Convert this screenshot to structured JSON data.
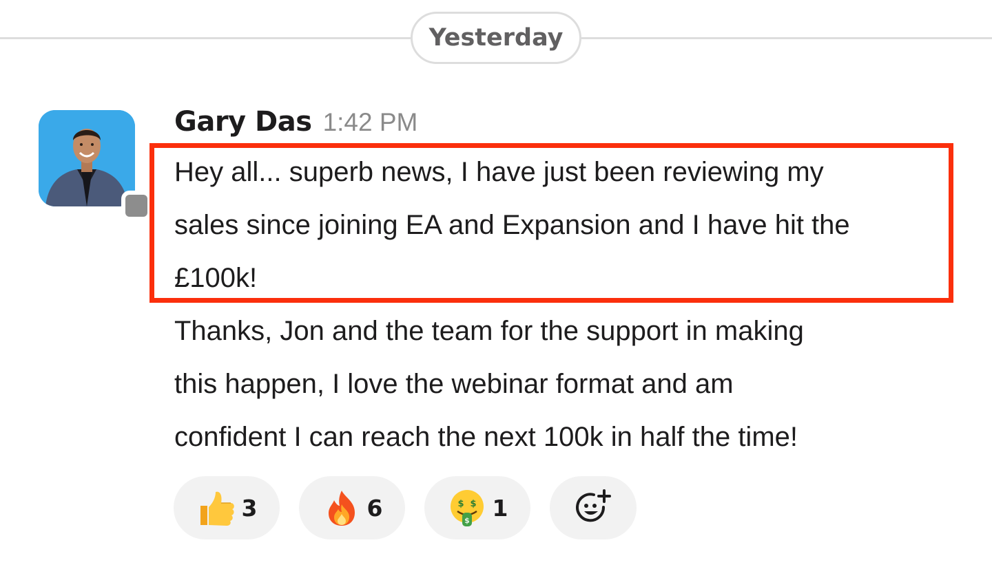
{
  "divider": {
    "label": "Yesterday"
  },
  "message": {
    "sender": "Gary Das",
    "time": "1:42 PM",
    "lines": [
      "Hey all... superb news, I have just been reviewing my",
      "sales since joining EA and Expansion and I have hit the",
      "£100k!",
      "Thanks, Jon and the team for the support in making",
      "this happen, I love the webinar format and am",
      "confident I can reach the next 100k in half the time!"
    ],
    "highlight_color": "#fb2f0c"
  },
  "reactions": [
    {
      "icon": "thumbs-up-icon",
      "count": "3"
    },
    {
      "icon": "fire-icon",
      "count": "6"
    },
    {
      "icon": "money-mouth-face-icon",
      "count": "1"
    },
    {
      "icon": "add-reaction-icon"
    }
  ],
  "colors": {
    "avatar_background": "#3aa9e9",
    "presence_away": "#8d8d8d",
    "reaction_background": "#f2f2f2"
  }
}
